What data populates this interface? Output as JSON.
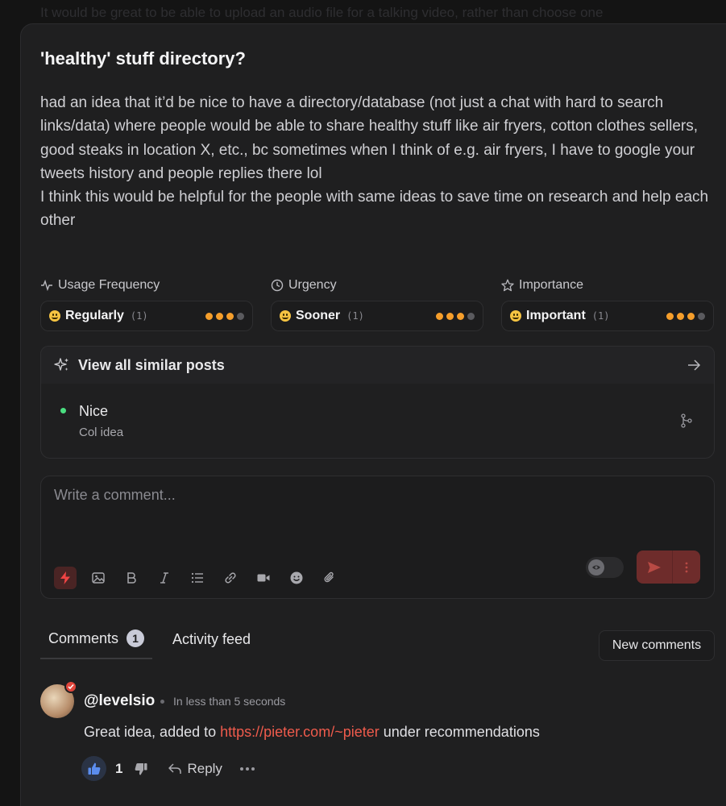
{
  "background_text": "It would be great to be able to upload an audio file for a talking video, rather than choose one",
  "post": {
    "title": "'healthy' stuff directory?",
    "description_lines": [
      "had an idea that it’d be nice to have a directory/database (not just a chat with hard to search links/data) where people would be able to share healthy stuff like air fryers, cotton clothes sellers, good steaks in location X, etc., bc sometimes when I think of e.g. air fryers, I have to google your tweets history and people replies there lol",
      "I think this would be helpful for the people with same ideas to save time on research and help each other"
    ]
  },
  "metrics": [
    {
      "label": "Usage Frequency",
      "icon": "activity-icon",
      "value": "Regularly",
      "count": "(1)",
      "level": 3,
      "max": 4
    },
    {
      "label": "Urgency",
      "icon": "clock-icon",
      "value": "Sooner",
      "count": "(1)",
      "level": 3,
      "max": 4
    },
    {
      "label": "Importance",
      "icon": "star-icon",
      "value": "Important",
      "count": "(1)",
      "level": 3,
      "max": 4
    }
  ],
  "similar": {
    "header": "View all similar posts",
    "item_title": "Nice",
    "item_subtitle": "Col idea"
  },
  "composer": {
    "placeholder": "Write a comment..."
  },
  "tabs": {
    "comments_label": "Comments",
    "comments_count": "1",
    "activity_label": "Activity feed",
    "new_comments": "New comments"
  },
  "comment": {
    "username": "@levelsio",
    "timestamp": "In less than 5 seconds",
    "text_before": "Great idea, added to ",
    "link": "https://pieter.com/~pieter",
    "text_after": " under recommendations",
    "likes": "1",
    "reply_label": "Reply"
  },
  "colors": {
    "accent": "#ef5b4c",
    "rating_dot": "#f59e2b",
    "online_dot": "#4ade80"
  }
}
